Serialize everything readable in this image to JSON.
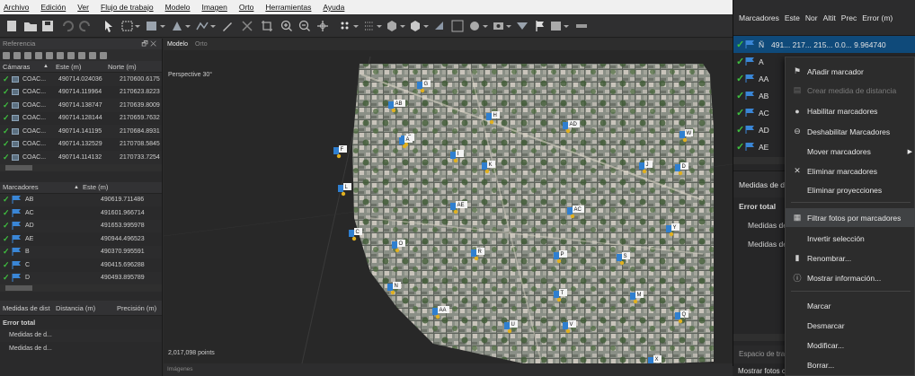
{
  "menu": [
    "Archivo",
    "Edición",
    "Ver",
    "Flujo de trabajo",
    "Modelo",
    "Imagen",
    "Orto",
    "Herramientas",
    "Ayuda"
  ],
  "left": {
    "reference_title": "Referencia",
    "reference_ctrl": "🗗 ✕",
    "cams_header": {
      "col1": "Cámaras",
      "col2": "Este (m)",
      "col3": "Norte (m)"
    },
    "cameras": [
      {
        "name": "COAC...",
        "east": "490714.024036",
        "north": "2170600.6175"
      },
      {
        "name": "COAC...",
        "east": "490714.119964",
        "north": "2170623.8223"
      },
      {
        "name": "COAC...",
        "east": "490714.138747",
        "north": "2170639.8009"
      },
      {
        "name": "COAC...",
        "east": "490714.128144",
        "north": "2170659.7632"
      },
      {
        "name": "COAC...",
        "east": "490714.141195",
        "north": "2170684.8931"
      },
      {
        "name": "COAC...",
        "east": "490714.132529",
        "north": "2170708.5845"
      },
      {
        "name": "COAC...",
        "east": "490714.114132",
        "north": "2170733.7254"
      }
    ],
    "markers_header": {
      "col1": "Marcadores",
      "col2": "Este (m)"
    },
    "markers": [
      {
        "name": "AB",
        "east": "490619.711486"
      },
      {
        "name": "AC",
        "east": "491601.966714"
      },
      {
        "name": "AD",
        "east": "491653.995978"
      },
      {
        "name": "AE",
        "east": "490944.496523"
      },
      {
        "name": "B",
        "east": "490370.995591"
      },
      {
        "name": "C",
        "east": "490415.696288"
      },
      {
        "name": "D",
        "east": "490493.895789"
      }
    ],
    "measures_header": {
      "col1": "Medidas de dist",
      "col2": "Distancia (m)",
      "col3": "Precisión (m)"
    },
    "error_total": "Error total",
    "measures": [
      "Medidas de d...",
      "Medidas de d..."
    ]
  },
  "viewport": {
    "tab_model": "Modelo",
    "tab_ortho": "Orto",
    "perspective": "Perspective 30°",
    "points": "2,017,098 points",
    "images_tab": "Imágenes",
    "marker_labels": [
      "G",
      "AB",
      "H",
      "E",
      "AD",
      "W",
      "I",
      "A",
      "J",
      "F",
      "K",
      "D",
      "L",
      "AE",
      "AC",
      "Y",
      "C",
      "O",
      "N",
      "R",
      "P",
      "S",
      "M",
      "T",
      "AA",
      "U",
      "Q",
      "V",
      "X"
    ]
  },
  "right": {
    "header": [
      "Marcadores",
      "Este",
      "Nor",
      "Altit",
      "Prec",
      "Error (m)"
    ],
    "rows": [
      {
        "name": "Ñ",
        "values": "491...  217...  215...  0.0...  9.964740",
        "selected": true
      },
      {
        "name": "A",
        "values": "",
        "selected": false
      },
      {
        "name": "AA",
        "values": "",
        "selected": false
      },
      {
        "name": "AB",
        "values": "",
        "selected": false
      },
      {
        "name": "AC",
        "values": "",
        "selected": false
      },
      {
        "name": "AD",
        "values": "",
        "selected": false
      },
      {
        "name": "AE",
        "values": "",
        "selected": false
      }
    ],
    "measures_title": "Medidas de d",
    "error_total": "Error total",
    "measures": [
      "Medidas de",
      "Medidas de"
    ],
    "workspace": "Espacio de trab",
    "status": "Mostrar fotos con marcadores seleccionados"
  },
  "context_menu": [
    {
      "label": "Añadir marcador",
      "icon": "add-marker-icon",
      "glyph": "⚑",
      "enabled": true
    },
    {
      "label": "Crear medida de distancia",
      "icon": "ruler-icon",
      "glyph": "📏",
      "enabled": false
    },
    {
      "label": "Habilitar marcadores",
      "icon": "check-circle-icon",
      "glyph": "●",
      "enabled": true
    },
    {
      "label": "Deshabilitar Marcadores",
      "icon": "minus-circle-icon",
      "glyph": "⊖",
      "enabled": true
    },
    {
      "label": "Mover marcadores",
      "icon": "",
      "glyph": "",
      "enabled": true,
      "submenu": true
    },
    {
      "label": "Eliminar marcadores",
      "icon": "close-icon",
      "glyph": "✕",
      "enabled": true
    },
    {
      "label": "Eliminar proyecciones",
      "icon": "",
      "glyph": "",
      "enabled": true
    },
    {
      "label": "Filtrar fotos por marcadores",
      "icon": "filter-photos-icon",
      "glyph": "▦",
      "enabled": true,
      "highlight": true
    },
    {
      "label": "Invertir selección",
      "icon": "",
      "glyph": "",
      "enabled": true
    },
    {
      "label": "Renombrar...",
      "icon": "rename-icon",
      "glyph": "▮",
      "enabled": true
    },
    {
      "label": "Mostrar información...",
      "icon": "info-icon",
      "glyph": "ⓘ",
      "enabled": true
    },
    {
      "label": "Marcar",
      "icon": "",
      "glyph": "",
      "enabled": true
    },
    {
      "label": "Desmarcar",
      "icon": "",
      "glyph": "",
      "enabled": true
    },
    {
      "label": "Modificar...",
      "icon": "",
      "glyph": "",
      "enabled": true
    },
    {
      "label": "Borrar...",
      "icon": "",
      "glyph": "",
      "enabled": true
    }
  ],
  "colors": {
    "accent": "#2f7fd0",
    "check": "#3fbf3f",
    "marker": "#e0b020",
    "selected": "#0f4a7a"
  }
}
